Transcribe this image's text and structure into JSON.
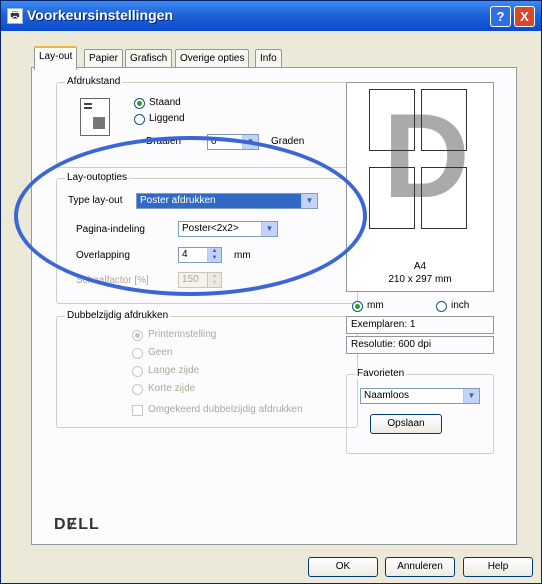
{
  "window": {
    "title": "Voorkeursinstellingen",
    "help_label": "?",
    "close_label": "X"
  },
  "tabs": [
    {
      "label": "Lay-out",
      "active": true
    },
    {
      "label": "Papier"
    },
    {
      "label": "Grafisch"
    },
    {
      "label": "Overige opties"
    },
    {
      "label": "Info"
    }
  ],
  "afdrukstand": {
    "title": "Afdrukstand",
    "staand": "Staand",
    "liggend": "Liggend",
    "draaien_label": "Draaien",
    "draaien_value": "0",
    "graden": "Graden",
    "selected": "Staand"
  },
  "layout_opties": {
    "title": "Lay-outopties",
    "type_label": "Type lay-out",
    "type_value": "Poster afdrukken",
    "pagina_label": "Pagina-indeling",
    "pagina_value": "Poster<2x2>",
    "overlapping_label": "Overlapping",
    "overlapping_value": "4",
    "overlapping_unit": "mm",
    "schaal_label": "Schaalfactor [%]",
    "schaal_value": "150"
  },
  "dubbelzijdig": {
    "title": "Dubbelzijdig afdrukken",
    "options": [
      "Printerinstelling",
      "Geen",
      "Lange zijde",
      "Korte zijde"
    ],
    "selected": "Printerinstelling",
    "omgekeerd": "Omgekeerd dubbelzijdig afdrukken"
  },
  "preview": {
    "paper": "A4",
    "size": "210 x 297 mm",
    "letter": "D"
  },
  "units": {
    "mm": "mm",
    "inch": "inch",
    "selected": "mm"
  },
  "info": {
    "exemplaren": "Exemplaren: 1",
    "resolutie": "Resolutie: 600 dpi"
  },
  "favorieten": {
    "title": "Favorieten",
    "value": "Naamloos",
    "save_label": "Opslaan"
  },
  "brand": "DɆLL",
  "buttons": {
    "ok": "OK",
    "cancel": "Annuleren",
    "help": "Help"
  },
  "colors": {
    "titlebar": "#0b4bcc",
    "highlight_oval": "#3b66d8",
    "selection": "#316ac5"
  }
}
